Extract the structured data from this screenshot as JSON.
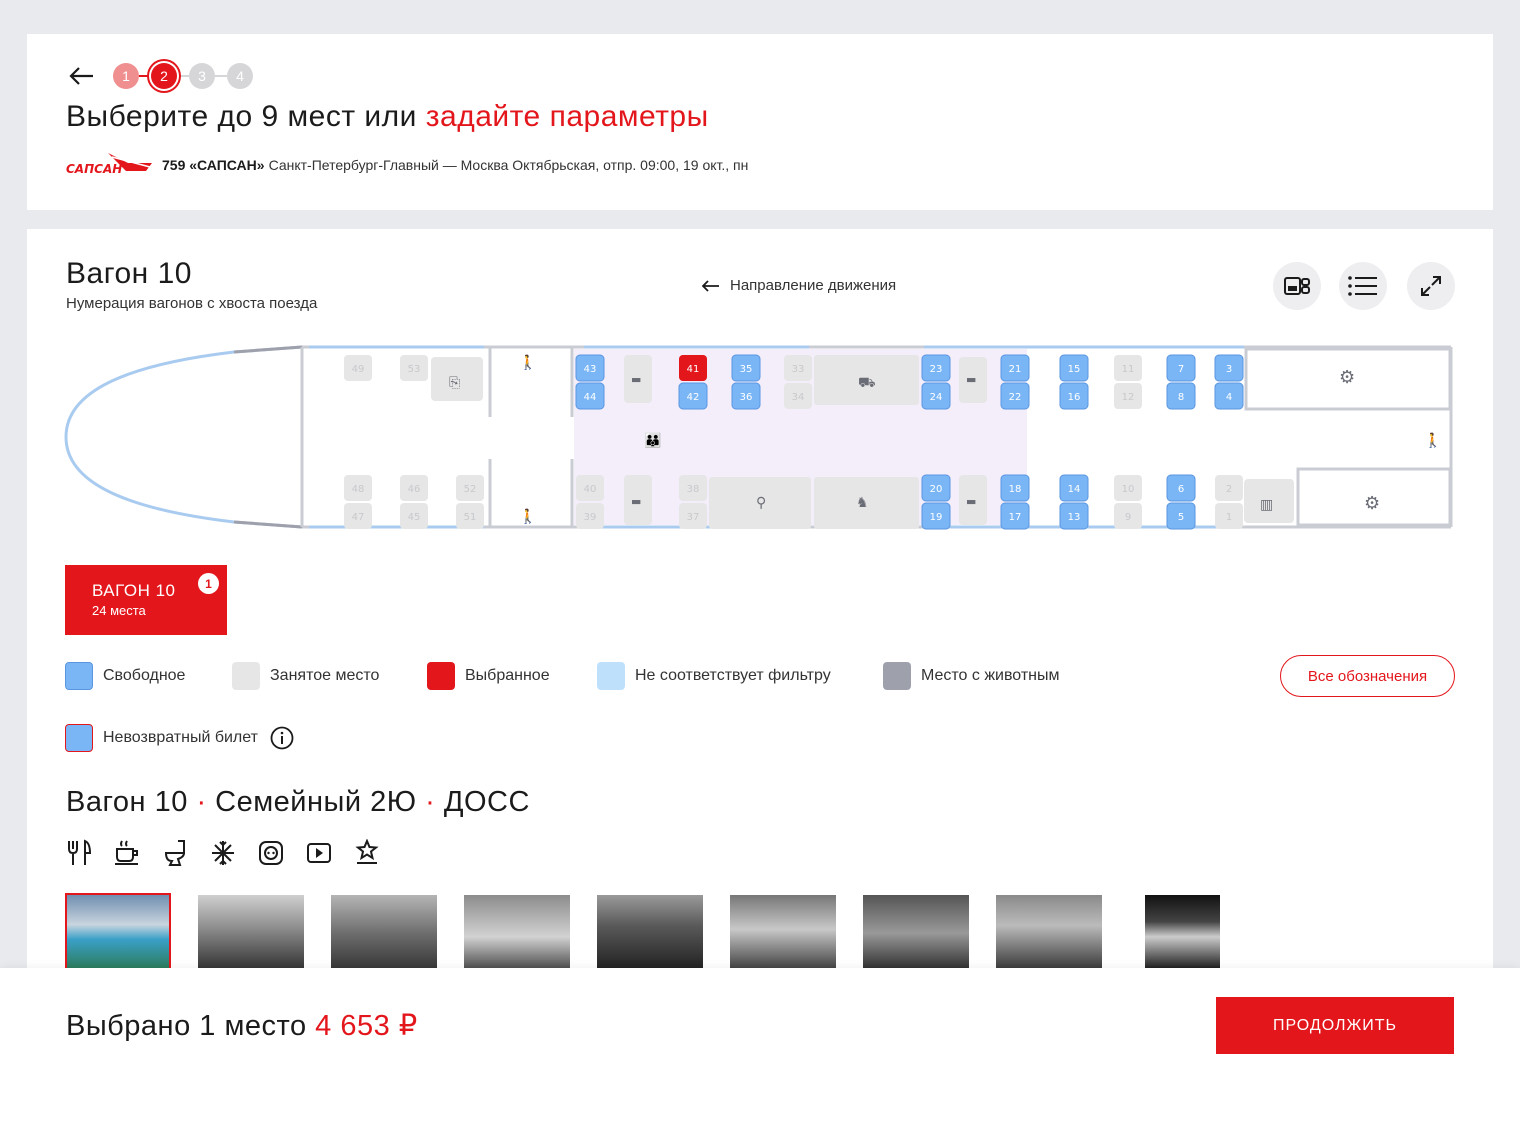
{
  "steps": [
    "1",
    "2",
    "3",
    "4"
  ],
  "header": {
    "title_prefix": "Выберите до 9 мест или",
    "title_link": "задайте параметры",
    "logo_text": "САПСАН",
    "train_number": "759 «САПСАН»",
    "route": "Санкт-Петербург-Главный — Москва Октябрьская, отпр. 09:00, 19 окт., пн"
  },
  "wagon": {
    "title": "Вагон 10",
    "subtitle": "Нумерация вагонов с хвоста поезда",
    "direction": "Направление движения"
  },
  "seats": {
    "free": [
      "43",
      "44",
      "42",
      "35",
      "36",
      "23",
      "24",
      "21",
      "22",
      "15",
      "16",
      "7",
      "8",
      "3",
      "4",
      "20",
      "19",
      "18",
      "17",
      "14",
      "13",
      "6",
      "5"
    ],
    "selected": [
      "41"
    ],
    "occupied": [
      "49",
      "53",
      "33",
      "34",
      "11",
      "12",
      "48",
      "47",
      "46",
      "45",
      "52",
      "51",
      "40",
      "39",
      "38",
      "37",
      "10",
      "9",
      "2",
      "1"
    ]
  },
  "wagon_chip": {
    "label": "ВАГОН 10",
    "seats": "24 места",
    "badge": "1"
  },
  "legend": {
    "free": "Свободное",
    "occupied": "Занятое место",
    "selected": "Выбранное",
    "no_filter": "Не соответствует фильтру",
    "pet": "Место с животным",
    "non_refund": "Невозвратный билет",
    "all_button": "Все обозначения"
  },
  "colors": {
    "accent": "#e3161c",
    "free": "#7ab6f6",
    "free_border": "#5a95e0",
    "occupied": "#e6e6e7",
    "no_filter": "#bfe0fb",
    "pet": "#9ea1ab"
  },
  "details": {
    "wagon": "Вагон 10",
    "sep": "·",
    "class": "Семейный 2Ю",
    "type": "ДОСС",
    "amenities": [
      "food-icon",
      "coffee-icon",
      "toilet-icon",
      "air-conditioning-icon",
      "socket-icon",
      "video-icon",
      "comfort-icon"
    ]
  },
  "photos": [
    "photo-1",
    "photo-2",
    "photo-3",
    "photo-4",
    "photo-5",
    "photo-6",
    "photo-7",
    "photo-8",
    "photo-9"
  ],
  "bottom": {
    "selected_label": "Выбрано 1 место",
    "price": "4 653 ₽",
    "continue": "ПРОДОЛЖИТЬ"
  }
}
